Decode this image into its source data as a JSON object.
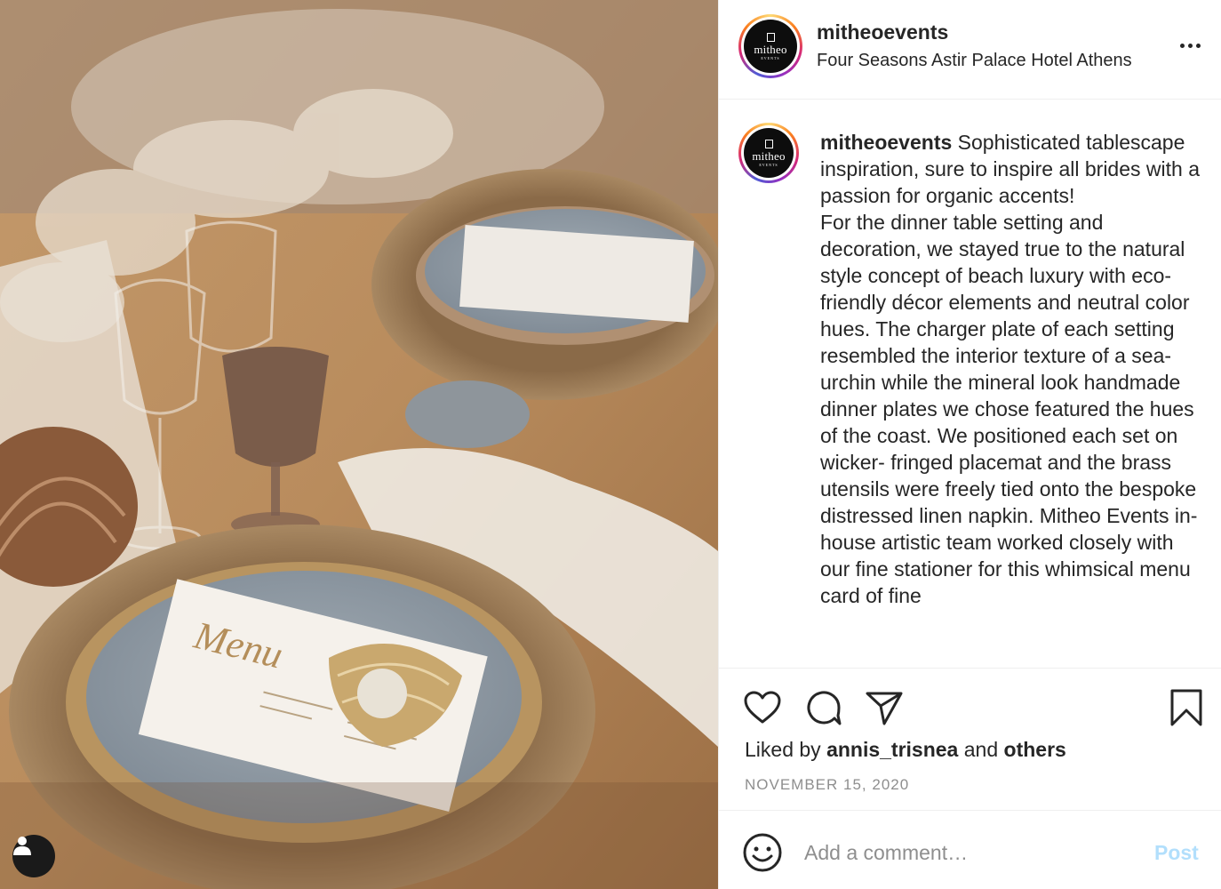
{
  "post": {
    "username": "mitheoevents",
    "location": "Four Seasons Astir Palace Hotel Athens",
    "avatar_brand": "mitheo",
    "avatar_sub": "EVENTS"
  },
  "caption": {
    "username": "mitheoevents",
    "text": " Sophisticated tablescape inspiration, sure to inspire all brides with a passion for organic accents!\nFor the dinner table setting and decoration, we stayed true to the natural style concept of beach luxury with eco-friendly décor elements and neutral color hues. The charger plate of each setting resembled the interior texture of a sea-urchin while the mineral look handmade dinner plates we chose featured the hues of the coast. We positioned each set on wicker- fringed placemat and the brass utensils were freely tied onto the bespoke distressed linen napkin. Mitheo Events in-house artistic team worked closely with our fine stationer for this whimsical menu card of fine"
  },
  "likes": {
    "prefix": "Liked by ",
    "user": "annis_trisnea",
    "middle": " and ",
    "others": "others"
  },
  "date": "NOVEMBER 15, 2020",
  "comment": {
    "placeholder": "Add a comment…",
    "post_label": "Post"
  },
  "photo": {
    "menu_script": "Menu"
  },
  "icons": {
    "like": "heart-icon",
    "comment": "comment-icon",
    "share": "share-icon",
    "save": "bookmark-icon",
    "emoji": "emoji-icon",
    "more": "more-icon",
    "tag": "user-tag-icon"
  },
  "colors": {
    "text": "#262626",
    "muted": "#8e8e8e",
    "post_disabled": "#b2dffc",
    "divider": "#efefef"
  }
}
